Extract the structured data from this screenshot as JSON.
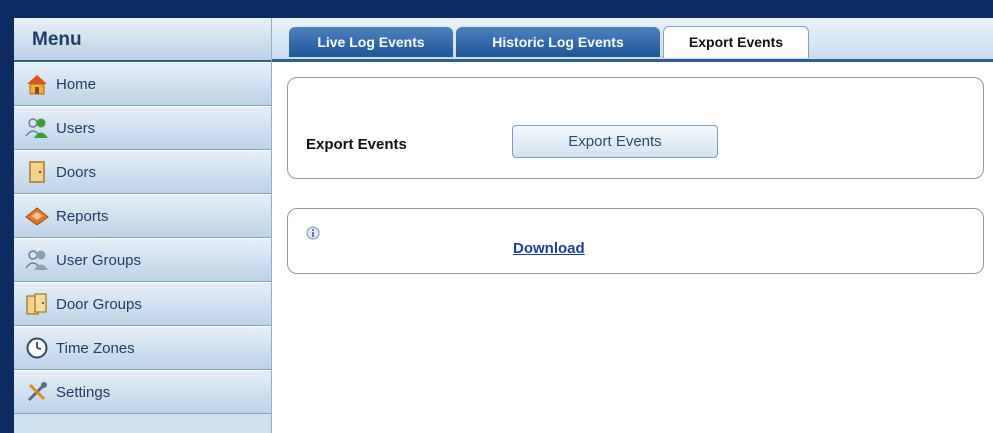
{
  "sidebar": {
    "title": "Menu",
    "items": [
      {
        "label": "Home",
        "icon": "home-icon"
      },
      {
        "label": "Users",
        "icon": "users-icon"
      },
      {
        "label": "Doors",
        "icon": "door-icon"
      },
      {
        "label": "Reports",
        "icon": "reports-icon"
      },
      {
        "label": "User Groups",
        "icon": "user-groups-icon"
      },
      {
        "label": "Door Groups",
        "icon": "door-groups-icon"
      },
      {
        "label": "Time Zones",
        "icon": "clock-icon"
      },
      {
        "label": "Settings",
        "icon": "settings-icon"
      }
    ]
  },
  "tabs": [
    {
      "label": "Live Log Events",
      "active": false
    },
    {
      "label": "Historic Log Events",
      "active": false
    },
    {
      "label": "Export Events",
      "active": true
    }
  ],
  "export_panel": {
    "label": "Export Events",
    "button_label": "Export Events"
  },
  "download_panel": {
    "link_label": "Download",
    "icon": "info-icon"
  },
  "colors": {
    "topbar": "#0e2a63",
    "tab_active_bg": "#ffffff",
    "tab_inactive_bg": "#1e5597",
    "link": "#1f3d9c"
  }
}
